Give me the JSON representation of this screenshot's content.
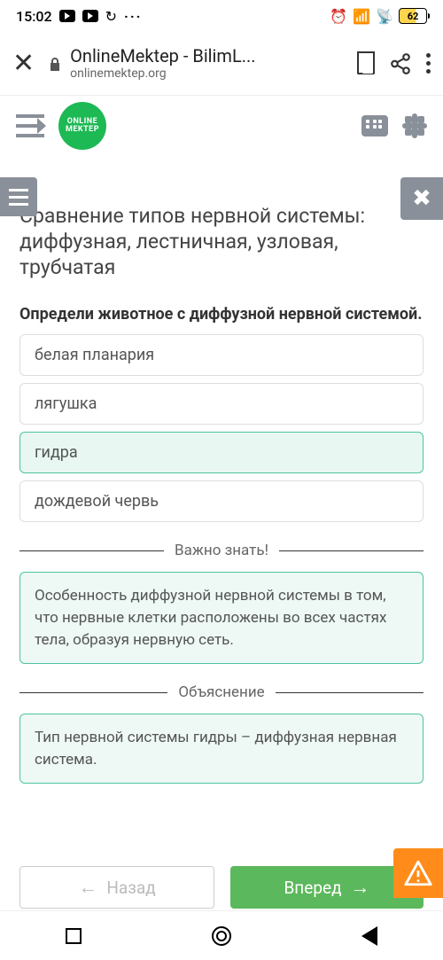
{
  "status": {
    "time": "15:02",
    "battery": "62"
  },
  "browser": {
    "title": "OnlineMektep - BilimL...",
    "domain": "onlinemektep.org"
  },
  "logo": {
    "line1": "ONLINE",
    "line2": "MEKTEP"
  },
  "topic_title": "Сравнение типов нервной системы: диффузная, лестничная, узловая, трубчатая",
  "question": "Определи животное с диффузной нервной системой.",
  "options": [
    {
      "label": "белая планария",
      "correct": false
    },
    {
      "label": "лягушка",
      "correct": false
    },
    {
      "label": "гидра",
      "correct": true
    },
    {
      "label": "дождевой червь",
      "correct": false
    }
  ],
  "important": {
    "heading": "Важно знать!",
    "text": "Особенность диффузной нервной системы в том, что нервные клетки расположены во всех частях тела, образуя нервную сеть."
  },
  "explanation": {
    "heading": "Объяснение",
    "text": "Тип нервной системы гидры – диффузная нервная система."
  },
  "nav": {
    "back": "Назад",
    "forward": "Вперед"
  }
}
